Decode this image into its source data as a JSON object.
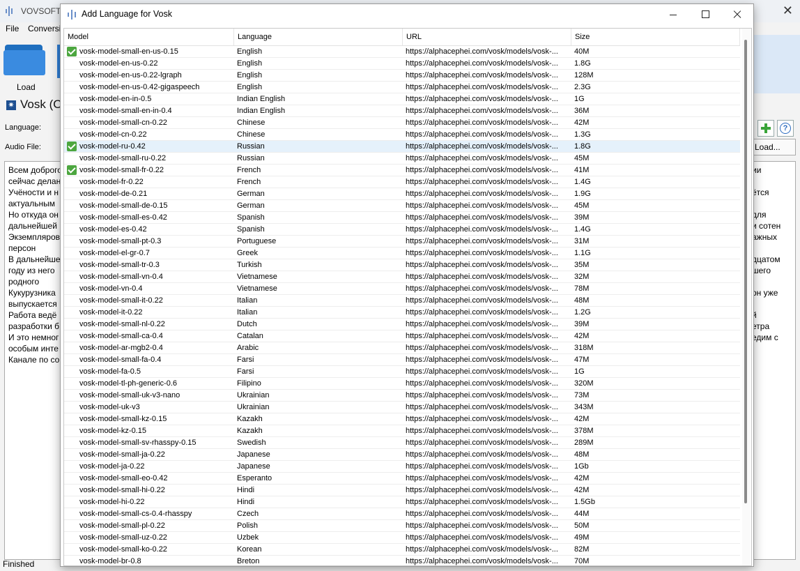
{
  "main_window": {
    "title": "VOVSOFT",
    "menu": [
      "File",
      "Conversi"
    ],
    "load_label": "Load",
    "engine_title": "Vosk (O",
    "language_label": "Language:",
    "audio_file_label": "Audio File:",
    "load_file_button": "Load...",
    "text_left": [
      "Всем доброго",
      "сейчас делан",
      "Учёности и н",
      "актуальным",
      "Но откуда он",
      "дальнейшей",
      "Экземпляров",
      "персон",
      "В дальнейше",
      "году из него",
      "родного",
      "Кукурузника",
      "выпускается",
      "Работа ведё",
      "разработки б",
      "И это немног",
      "особым инте",
      "Канале по со"
    ],
    "text_right": [
      "ии",
      "",
      "ётся",
      "",
      "для",
      "и сотен",
      "ажных",
      "",
      "дцатом",
      "шего",
      "",
      "он уже",
      "",
      "й",
      "етра",
      "едим с",
      "",
      ""
    ],
    "status": "Finished"
  },
  "dialog": {
    "title": "Add Language for Vosk",
    "columns": [
      "Model",
      "Language",
      "URL",
      "Size"
    ],
    "rows": [
      {
        "model": "vosk-model-small-en-us-0.15",
        "language": "English",
        "url": "https://alphacephei.com/vosk/models/vosk-...",
        "size": "40M",
        "installed": true,
        "selected": false
      },
      {
        "model": "vosk-model-en-us-0.22",
        "language": "English",
        "url": "https://alphacephei.com/vosk/models/vosk-...",
        "size": "1.8G",
        "installed": false,
        "selected": false
      },
      {
        "model": "vosk-model-en-us-0.22-lgraph",
        "language": "English",
        "url": "https://alphacephei.com/vosk/models/vosk-...",
        "size": "128M",
        "installed": false,
        "selected": false
      },
      {
        "model": "vosk-model-en-us-0.42-gigaspeech",
        "language": "English",
        "url": "https://alphacephei.com/vosk/models/vosk-...",
        "size": "2.3G",
        "installed": false,
        "selected": false
      },
      {
        "model": "vosk-model-en-in-0.5",
        "language": "Indian English",
        "url": "https://alphacephei.com/vosk/models/vosk-...",
        "size": "1G",
        "installed": false,
        "selected": false
      },
      {
        "model": "vosk-model-small-en-in-0.4",
        "language": "Indian English",
        "url": "https://alphacephei.com/vosk/models/vosk-...",
        "size": "36M",
        "installed": false,
        "selected": false
      },
      {
        "model": "vosk-model-small-cn-0.22",
        "language": "Chinese",
        "url": "https://alphacephei.com/vosk/models/vosk-...",
        "size": "42M",
        "installed": false,
        "selected": false
      },
      {
        "model": "vosk-model-cn-0.22",
        "language": "Chinese",
        "url": "https://alphacephei.com/vosk/models/vosk-...",
        "size": "1.3G",
        "installed": false,
        "selected": false
      },
      {
        "model": "vosk-model-ru-0.42",
        "language": "Russian",
        "url": "https://alphacephei.com/vosk/models/vosk-...",
        "size": "1.8G",
        "installed": true,
        "selected": true
      },
      {
        "model": "vosk-model-small-ru-0.22",
        "language": "Russian",
        "url": "https://alphacephei.com/vosk/models/vosk-...",
        "size": "45M",
        "installed": false,
        "selected": false
      },
      {
        "model": "vosk-model-small-fr-0.22",
        "language": "French",
        "url": "https://alphacephei.com/vosk/models/vosk-...",
        "size": "41M",
        "installed": true,
        "selected": false
      },
      {
        "model": "vosk-model-fr-0.22",
        "language": "French",
        "url": "https://alphacephei.com/vosk/models/vosk-...",
        "size": "1.4G",
        "installed": false,
        "selected": false
      },
      {
        "model": "vosk-model-de-0.21",
        "language": "German",
        "url": "https://alphacephei.com/vosk/models/vosk-...",
        "size": "1.9G",
        "installed": false,
        "selected": false
      },
      {
        "model": "vosk-model-small-de-0.15",
        "language": "German",
        "url": "https://alphacephei.com/vosk/models/vosk-...",
        "size": "45M",
        "installed": false,
        "selected": false
      },
      {
        "model": "vosk-model-small-es-0.42",
        "language": "Spanish",
        "url": "https://alphacephei.com/vosk/models/vosk-...",
        "size": "39M",
        "installed": false,
        "selected": false
      },
      {
        "model": "vosk-model-es-0.42",
        "language": "Spanish",
        "url": "https://alphacephei.com/vosk/models/vosk-...",
        "size": "1.4G",
        "installed": false,
        "selected": false
      },
      {
        "model": "vosk-model-small-pt-0.3",
        "language": "Portuguese",
        "url": "https://alphacephei.com/vosk/models/vosk-...",
        "size": "31M",
        "installed": false,
        "selected": false
      },
      {
        "model": "vosk-model-el-gr-0.7",
        "language": "Greek",
        "url": "https://alphacephei.com/vosk/models/vosk-...",
        "size": "1.1G",
        "installed": false,
        "selected": false
      },
      {
        "model": "vosk-model-small-tr-0.3",
        "language": "Turkish",
        "url": "https://alphacephei.com/vosk/models/vosk-...",
        "size": "35M",
        "installed": false,
        "selected": false
      },
      {
        "model": "vosk-model-small-vn-0.4",
        "language": "Vietnamese",
        "url": "https://alphacephei.com/vosk/models/vosk-...",
        "size": "32M",
        "installed": false,
        "selected": false
      },
      {
        "model": "vosk-model-vn-0.4",
        "language": "Vietnamese",
        "url": "https://alphacephei.com/vosk/models/vosk-...",
        "size": "78M",
        "installed": false,
        "selected": false
      },
      {
        "model": "vosk-model-small-it-0.22",
        "language": "Italian",
        "url": "https://alphacephei.com/vosk/models/vosk-...",
        "size": "48M",
        "installed": false,
        "selected": false
      },
      {
        "model": "vosk-model-it-0.22",
        "language": "Italian",
        "url": "https://alphacephei.com/vosk/models/vosk-...",
        "size": "1.2G",
        "installed": false,
        "selected": false
      },
      {
        "model": "vosk-model-small-nl-0.22",
        "language": "Dutch",
        "url": "https://alphacephei.com/vosk/models/vosk-...",
        "size": "39M",
        "installed": false,
        "selected": false
      },
      {
        "model": "vosk-model-small-ca-0.4",
        "language": "Catalan",
        "url": "https://alphacephei.com/vosk/models/vosk-...",
        "size": "42M",
        "installed": false,
        "selected": false
      },
      {
        "model": "vosk-model-ar-mgb2-0.4",
        "language": "Arabic",
        "url": "https://alphacephei.com/vosk/models/vosk-...",
        "size": "318M",
        "installed": false,
        "selected": false
      },
      {
        "model": "vosk-model-small-fa-0.4",
        "language": "Farsi",
        "url": "https://alphacephei.com/vosk/models/vosk-...",
        "size": "47M",
        "installed": false,
        "selected": false
      },
      {
        "model": "vosk-model-fa-0.5",
        "language": "Farsi",
        "url": "https://alphacephei.com/vosk/models/vosk-...",
        "size": "1G",
        "installed": false,
        "selected": false
      },
      {
        "model": "vosk-model-tl-ph-generic-0.6",
        "language": "Filipino",
        "url": "https://alphacephei.com/vosk/models/vosk-...",
        "size": "320M",
        "installed": false,
        "selected": false
      },
      {
        "model": "vosk-model-small-uk-v3-nano",
        "language": "Ukrainian",
        "url": "https://alphacephei.com/vosk/models/vosk-...",
        "size": "73M",
        "installed": false,
        "selected": false
      },
      {
        "model": "vosk-model-uk-v3",
        "language": "Ukrainian",
        "url": "https://alphacephei.com/vosk/models/vosk-...",
        "size": "343M",
        "installed": false,
        "selected": false
      },
      {
        "model": "vosk-model-small-kz-0.15",
        "language": "Kazakh",
        "url": "https://alphacephei.com/vosk/models/vosk-...",
        "size": "42M",
        "installed": false,
        "selected": false
      },
      {
        "model": "vosk-model-kz-0.15",
        "language": "Kazakh",
        "url": "https://alphacephei.com/vosk/models/vosk-...",
        "size": "378M",
        "installed": false,
        "selected": false
      },
      {
        "model": "vosk-model-small-sv-rhasspy-0.15",
        "language": "Swedish",
        "url": "https://alphacephei.com/vosk/models/vosk-...",
        "size": "289M",
        "installed": false,
        "selected": false
      },
      {
        "model": "vosk-model-small-ja-0.22",
        "language": "Japanese",
        "url": "https://alphacephei.com/vosk/models/vosk-...",
        "size": "48M",
        "installed": false,
        "selected": false
      },
      {
        "model": "vosk-model-ja-0.22",
        "language": "Japanese",
        "url": "https://alphacephei.com/vosk/models/vosk-...",
        "size": "1Gb",
        "installed": false,
        "selected": false
      },
      {
        "model": "vosk-model-small-eo-0.42",
        "language": "Esperanto",
        "url": "https://alphacephei.com/vosk/models/vosk-...",
        "size": "42M",
        "installed": false,
        "selected": false
      },
      {
        "model": "vosk-model-small-hi-0.22",
        "language": "Hindi",
        "url": "https://alphacephei.com/vosk/models/vosk-...",
        "size": "42M",
        "installed": false,
        "selected": false
      },
      {
        "model": "vosk-model-hi-0.22",
        "language": "Hindi",
        "url": "https://alphacephei.com/vosk/models/vosk-...",
        "size": "1.5Gb",
        "installed": false,
        "selected": false
      },
      {
        "model": "vosk-model-small-cs-0.4-rhasspy",
        "language": "Czech",
        "url": "https://alphacephei.com/vosk/models/vosk-...",
        "size": "44M",
        "installed": false,
        "selected": false
      },
      {
        "model": "vosk-model-small-pl-0.22",
        "language": "Polish",
        "url": "https://alphacephei.com/vosk/models/vosk-...",
        "size": "50M",
        "installed": false,
        "selected": false
      },
      {
        "model": "vosk-model-small-uz-0.22",
        "language": "Uzbek",
        "url": "https://alphacephei.com/vosk/models/vosk-...",
        "size": "49M",
        "installed": false,
        "selected": false
      },
      {
        "model": "vosk-model-small-ko-0.22",
        "language": "Korean",
        "url": "https://alphacephei.com/vosk/models/vosk-...",
        "size": "82M",
        "installed": false,
        "selected": false
      },
      {
        "model": "vosk-model-br-0.8",
        "language": "Breton",
        "url": "https://alphacephei.com/vosk/models/vosk-...",
        "size": "70M",
        "installed": false,
        "selected": false
      }
    ]
  },
  "icons": {
    "app": "audio-wave-icon",
    "load": "folder-icon",
    "engine": "engine-star-icon",
    "add": "plus-icon",
    "help": "help-icon",
    "installed": "check-icon"
  },
  "colors": {
    "selected_row": "#e5f1fb",
    "check_green": "#4ca63f",
    "folder_blue": "#3a8be0"
  }
}
